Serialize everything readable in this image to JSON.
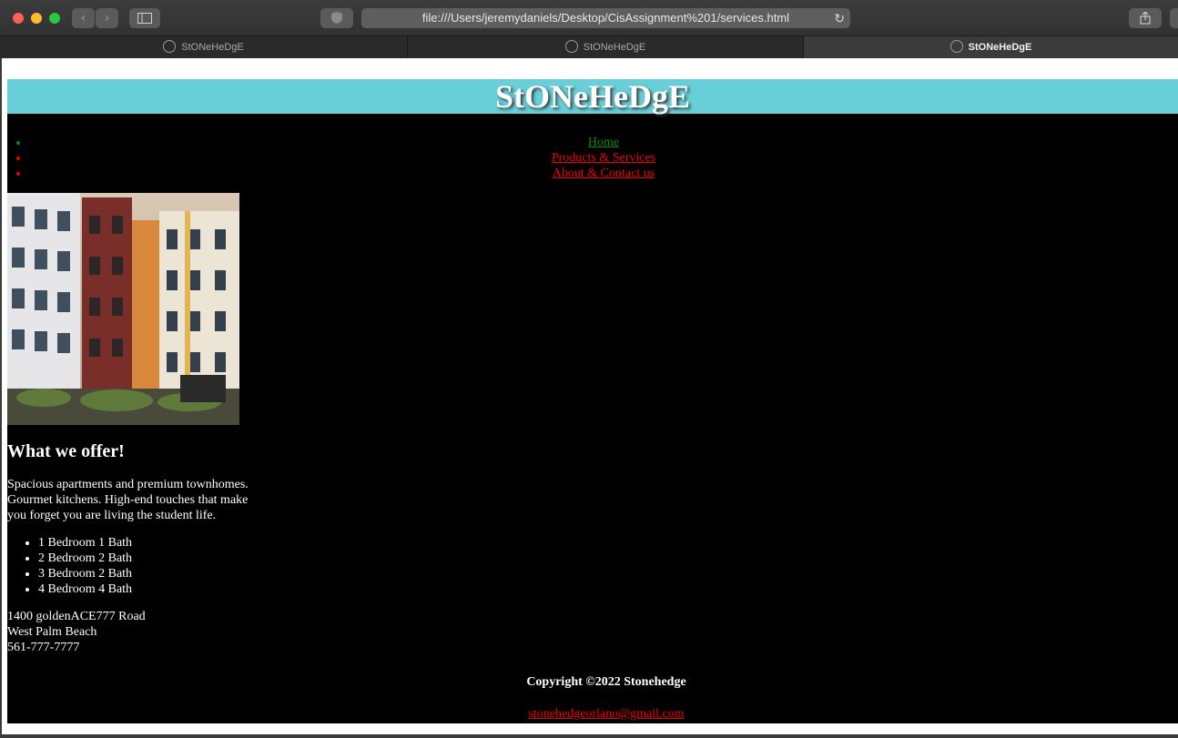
{
  "browser": {
    "url": "file:///Users/jeremydaniels/Desktop/CisAssignment%201/services.html",
    "tabs": [
      "StONeHeDgE",
      "StONeHeDgE",
      "StONeHeDgE"
    ]
  },
  "site": {
    "title": "StONeHeDgE",
    "nav": [
      "Home",
      "Products & Services",
      "About & Contact us"
    ],
    "heading": "What we offer!",
    "intro": "Spacious apartments and premium townhomes. Gourmet kitchens. High-end touches that make you forget you are living the student life.",
    "units": [
      "1 Bedroom 1 Bath",
      "2 Bedroom 2 Bath",
      "3 Bedroom 2 Bath",
      "4 Bedroom 4 Bath"
    ],
    "address": [
      "1400 goldenACE777 Road",
      "West Palm Beach",
      "561-777-7777"
    ],
    "copyright": "Copyright ©2022 Stonehedge",
    "email": "stonehedgeorlano@gmail.com"
  },
  "colors": {
    "header_bg": "#68cfd8",
    "page_bg": "#000000",
    "link_active": "#0a8a0a",
    "link": "#ee0000"
  },
  "icons": [
    "close-light",
    "minimize-light",
    "maximize-light",
    "back-icon",
    "forward-icon",
    "sidebar-icon",
    "shield-icon",
    "reload-icon",
    "share-icon",
    "compass-icon"
  ]
}
